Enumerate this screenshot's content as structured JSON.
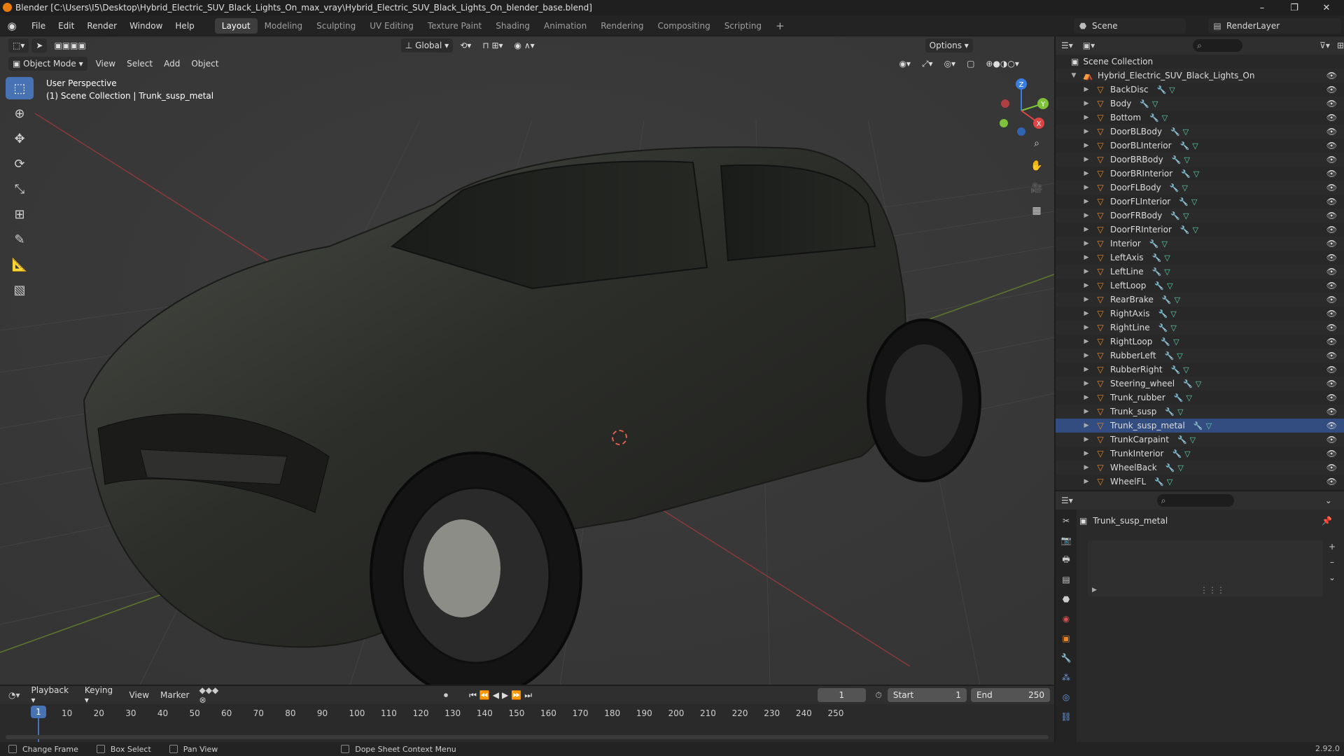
{
  "window": {
    "title": "Blender [C:\\Users\\I5\\Desktop\\Hybrid_Electric_SUV_Black_Lights_On_max_vray\\Hybrid_Electric_SUV_Black_Lights_On_blender_base.blend]",
    "minimize": "–",
    "restore": "❐",
    "close": "✕"
  },
  "menubar": {
    "items": [
      "File",
      "Edit",
      "Render",
      "Window",
      "Help"
    ],
    "workspaces": [
      "Layout",
      "Modeling",
      "Sculpting",
      "UV Editing",
      "Texture Paint",
      "Shading",
      "Animation",
      "Rendering",
      "Compositing",
      "Scripting"
    ],
    "active_workspace": "Layout",
    "add_workspace": "+",
    "scene": "Scene",
    "render_layer": "RenderLayer"
  },
  "viewport": {
    "mode": "Object Mode",
    "menus": [
      "View",
      "Select",
      "Add",
      "Object"
    ],
    "orientation": "Global",
    "options_label": "Options",
    "overlay_line1": "User Perspective",
    "overlay_line2": "(1) Scene Collection | Trunk_susp_metal",
    "gizmo_axes": {
      "x": "X",
      "y": "Y",
      "z": "Z"
    },
    "axis_colors": {
      "x": "#e04545",
      "y": "#7ec23a",
      "z": "#3a7de0"
    }
  },
  "outliner": {
    "root": "Scene Collection",
    "collection": "Hybrid_Electric_SUV_Black_Lights_On",
    "objects": [
      "BackDisc",
      "Body",
      "Bottom",
      "DoorBLBody",
      "DoorBLInterior",
      "DoorBRBody",
      "DoorBRInterior",
      "DoorFLBody",
      "DoorFLInterior",
      "DoorFRBody",
      "DoorFRInterior",
      "Interior",
      "LeftAxis",
      "LeftLine",
      "LeftLoop",
      "RearBrake",
      "RightAxis",
      "RightLine",
      "RightLoop",
      "RubberLeft",
      "RubberRight",
      "Steering_wheel",
      "Trunk_rubber",
      "Trunk_susp",
      "Trunk_susp_metal",
      "TrunkCarpaint",
      "TrunkInterior",
      "WheelBack",
      "WheelFL"
    ],
    "active_object": "Trunk_susp_metal"
  },
  "properties": {
    "object_name": "Trunk_susp_metal",
    "add_btn": "+",
    "remove_btn": "–",
    "menu_btn": "⌄"
  },
  "timeline": {
    "menus": [
      "Playback",
      "Keying",
      "View",
      "Marker"
    ],
    "current_frame": "1",
    "start_label": "Start",
    "start": "1",
    "end_label": "End",
    "end": "250",
    "ticks": [
      "10",
      "20",
      "30",
      "40",
      "50",
      "60",
      "70",
      "80",
      "90",
      "100",
      "110",
      "120",
      "130",
      "140",
      "150",
      "160",
      "170",
      "180",
      "190",
      "200",
      "210",
      "220",
      "230",
      "240",
      "250"
    ],
    "playhead_label": "1"
  },
  "statusbar": {
    "items": [
      "Change Frame",
      "Box Select",
      "Pan View",
      "Dope Sheet Context Menu"
    ],
    "version": "2.92.0"
  },
  "colors": {
    "accent": "#4772b3",
    "object_icon": "#e7892a",
    "mesh_icon": "#5ed3b0",
    "modifier_icon": "#8aa7d8"
  }
}
